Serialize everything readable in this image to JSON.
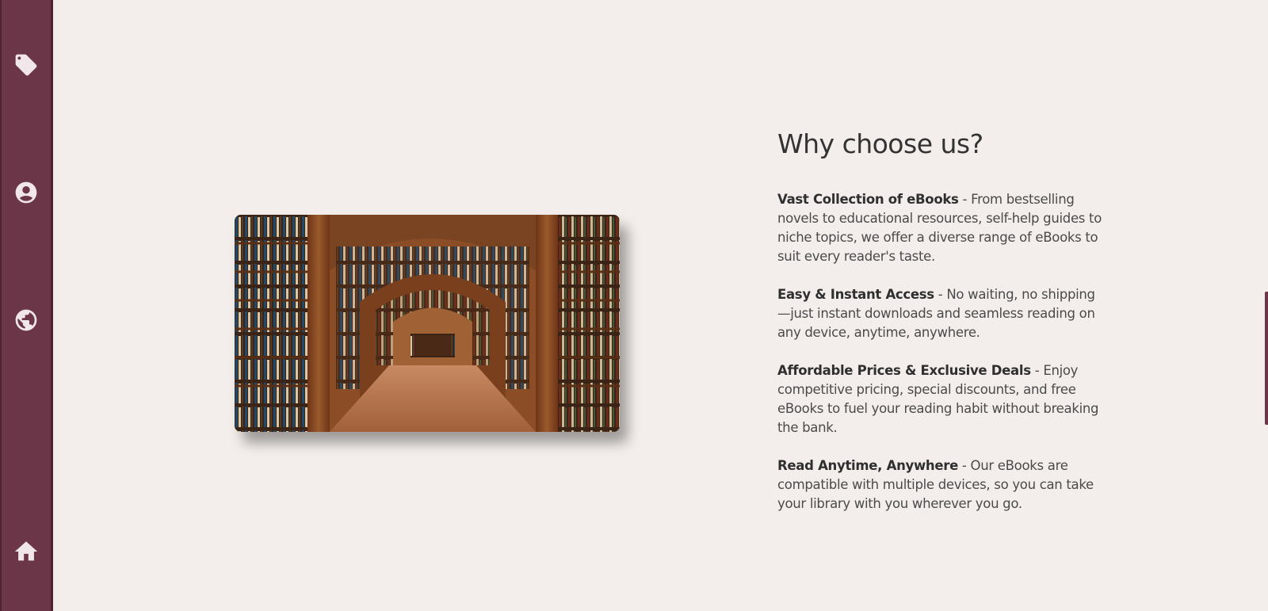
{
  "sidebar": {
    "icons": [
      "tag-icon",
      "user-icon",
      "globe-icon",
      "home-icon"
    ]
  },
  "colors": {
    "sidebar_bg": "#6b3648",
    "page_bg": "#f3eeeb",
    "text": "#3a3a3a"
  },
  "hero_image": {
    "alt": "Library with wooden bookshelves and arches"
  },
  "section": {
    "heading": "Why choose us?",
    "features": [
      {
        "title": "Vast Collection of eBooks",
        "text": " - From bestselling novels to educational resources, self-help guides to niche topics, we offer a diverse range of eBooks to suit every reader's taste."
      },
      {
        "title": "Easy & Instant Access",
        "text": " - No waiting, no shipping—just instant downloads and seamless reading on any device, anytime, anywhere."
      },
      {
        "title": "Affordable Prices & Exclusive Deals",
        "text": " - Enjoy competitive pricing, special discounts, and free eBooks to fuel your reading habit without breaking the bank."
      },
      {
        "title": "Read Anytime, Anywhere",
        "text": " - Our eBooks are compatible with multiple devices, so you can take your library with you wherever you go."
      }
    ]
  }
}
